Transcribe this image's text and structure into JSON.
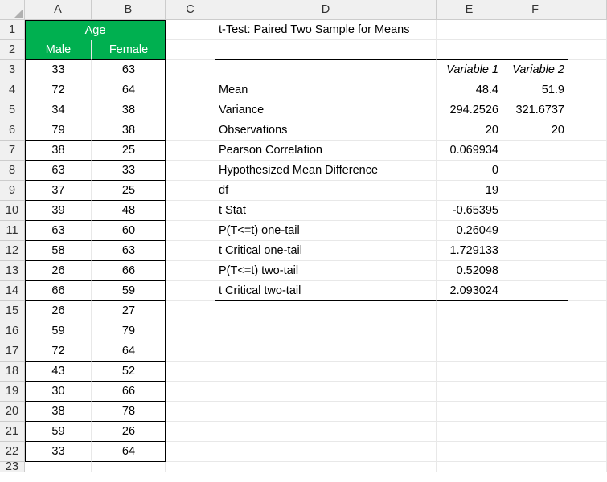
{
  "columns": [
    "A",
    "B",
    "C",
    "D",
    "E",
    "F",
    ""
  ],
  "age_header": "Age",
  "subheaders": {
    "male": "Male",
    "female": "Female"
  },
  "data_ab": [
    [
      33,
      63
    ],
    [
      72,
      64
    ],
    [
      34,
      38
    ],
    [
      79,
      38
    ],
    [
      38,
      25
    ],
    [
      63,
      33
    ],
    [
      37,
      25
    ],
    [
      39,
      48
    ],
    [
      63,
      60
    ],
    [
      58,
      63
    ],
    [
      26,
      66
    ],
    [
      66,
      59
    ],
    [
      26,
      27
    ],
    [
      59,
      79
    ],
    [
      72,
      64
    ],
    [
      43,
      52
    ],
    [
      30,
      66
    ],
    [
      38,
      78
    ],
    [
      59,
      26
    ],
    [
      33,
      64
    ]
  ],
  "ttest_title": "t-Test: Paired Two Sample for Means",
  "var_headers": {
    "v1": "Variable 1",
    "v2": "Variable 2"
  },
  "stats": [
    {
      "label": "Mean",
      "v1": "48.4",
      "v2": "51.9"
    },
    {
      "label": "Variance",
      "v1": "294.2526",
      "v2": "321.6737"
    },
    {
      "label": "Observations",
      "v1": "20",
      "v2": "20"
    },
    {
      "label": "Pearson Correlation",
      "v1": "0.069934",
      "v2": ""
    },
    {
      "label": "Hypothesized Mean Difference",
      "v1": "0",
      "v2": ""
    },
    {
      "label": "df",
      "v1": "19",
      "v2": ""
    },
    {
      "label": "t Stat",
      "v1": "-0.65395",
      "v2": ""
    },
    {
      "label": "P(T<=t) one-tail",
      "v1": "0.26049",
      "v2": ""
    },
    {
      "label": "t Critical one-tail",
      "v1": "1.729133",
      "v2": ""
    },
    {
      "label": "P(T<=t) two-tail",
      "v1": "0.52098",
      "v2": ""
    },
    {
      "label": "t Critical two-tail",
      "v1": "2.093024",
      "v2": ""
    }
  ]
}
